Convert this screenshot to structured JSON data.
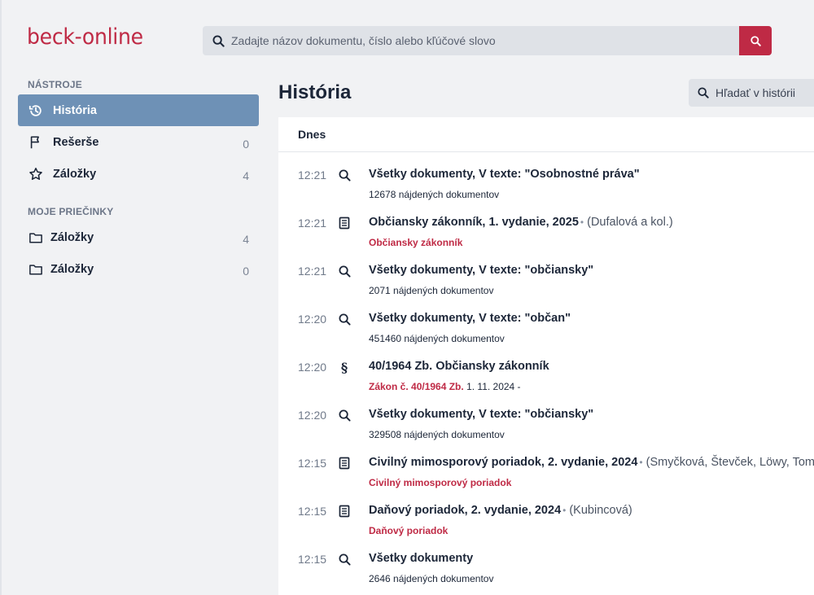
{
  "brand": {
    "logo_text": "beck-online",
    "color": "#bf2a45"
  },
  "search": {
    "placeholder": "Zadajte názov dokumentu, číslo alebo kľúčové slovo"
  },
  "sidebar": {
    "tools_title": "NÁSTROJE",
    "tools": [
      {
        "label": "História",
        "count": "",
        "icon": "history-icon",
        "active": true
      },
      {
        "label": "Rešerše",
        "count": "0",
        "icon": "flag-icon"
      },
      {
        "label": "Záložky",
        "count": "4",
        "icon": "star-icon"
      }
    ],
    "folders_title": "MOJE PRIEČINKY",
    "folders": [
      {
        "label": "Záložky",
        "count": "4",
        "icon": "folder-icon"
      },
      {
        "label": "Záložky",
        "count": "0",
        "icon": "folder-icon"
      }
    ]
  },
  "main": {
    "title": "História",
    "history_search": {
      "placeholder": "Hľadať v histórii"
    },
    "day_label": "Dnes",
    "entries": [
      {
        "time": "12:21",
        "icon": "search-icon",
        "title": "Všetky dokumenty, V texte: \"Osobnostné práva\"",
        "authors": "",
        "sub": "12678 nájdených dokumentov",
        "sub_extra": ""
      },
      {
        "time": "12:21",
        "icon": "book-icon",
        "title": "Občiansky zákonník, 1. vydanie, 2025",
        "authors": "(Dufalová a kol.)",
        "sub": "Občiansky zákonník",
        "sub_extra": ""
      },
      {
        "time": "12:21",
        "icon": "search-icon",
        "title": "Všetky dokumenty, V texte: \"občiansky\"",
        "authors": "",
        "sub": "2071 nájdených dokumentov",
        "sub_extra": ""
      },
      {
        "time": "12:20",
        "icon": "search-icon",
        "title": "Všetky dokumenty, V texte: \"občan\"",
        "authors": "",
        "sub": "451460 nájdených dokumentov",
        "sub_extra": ""
      },
      {
        "time": "12:20",
        "icon": "paragraph-icon",
        "title": "40/1964 Zb. Občiansky zákonník",
        "authors": "",
        "sub": "Zákon č. 40/1964 Zb.",
        "sub_extra": "1. 11. 2024 -"
      },
      {
        "time": "12:20",
        "icon": "search-icon",
        "title": "Všetky dokumenty, V texte: \"občiansky\"",
        "authors": "",
        "sub": "329508 nájdených dokumentov",
        "sub_extra": ""
      },
      {
        "time": "12:15",
        "icon": "book-icon",
        "title": "Civilný mimosporový poriadok, 2. vydanie, 2024",
        "authors": "(Smyčková, Števček, Löwy, Tomašovič",
        "sub": "Civilný mimosporový poriadok",
        "sub_extra": ""
      },
      {
        "time": "12:15",
        "icon": "book-icon",
        "title": "Daňový poriadok, 2. vydanie, 2024",
        "authors": "(Kubincová)",
        "sub": "Daňový poriadok",
        "sub_extra": ""
      },
      {
        "time": "12:15",
        "icon": "search-icon",
        "title": "Všetky dokumenty",
        "authors": "",
        "sub": "2646 nájdených dokumentov",
        "sub_extra": ""
      }
    ]
  },
  "colors": {
    "accent": "#bf2a45",
    "active_nav": "#6e91b6",
    "text": "#1c2638"
  }
}
